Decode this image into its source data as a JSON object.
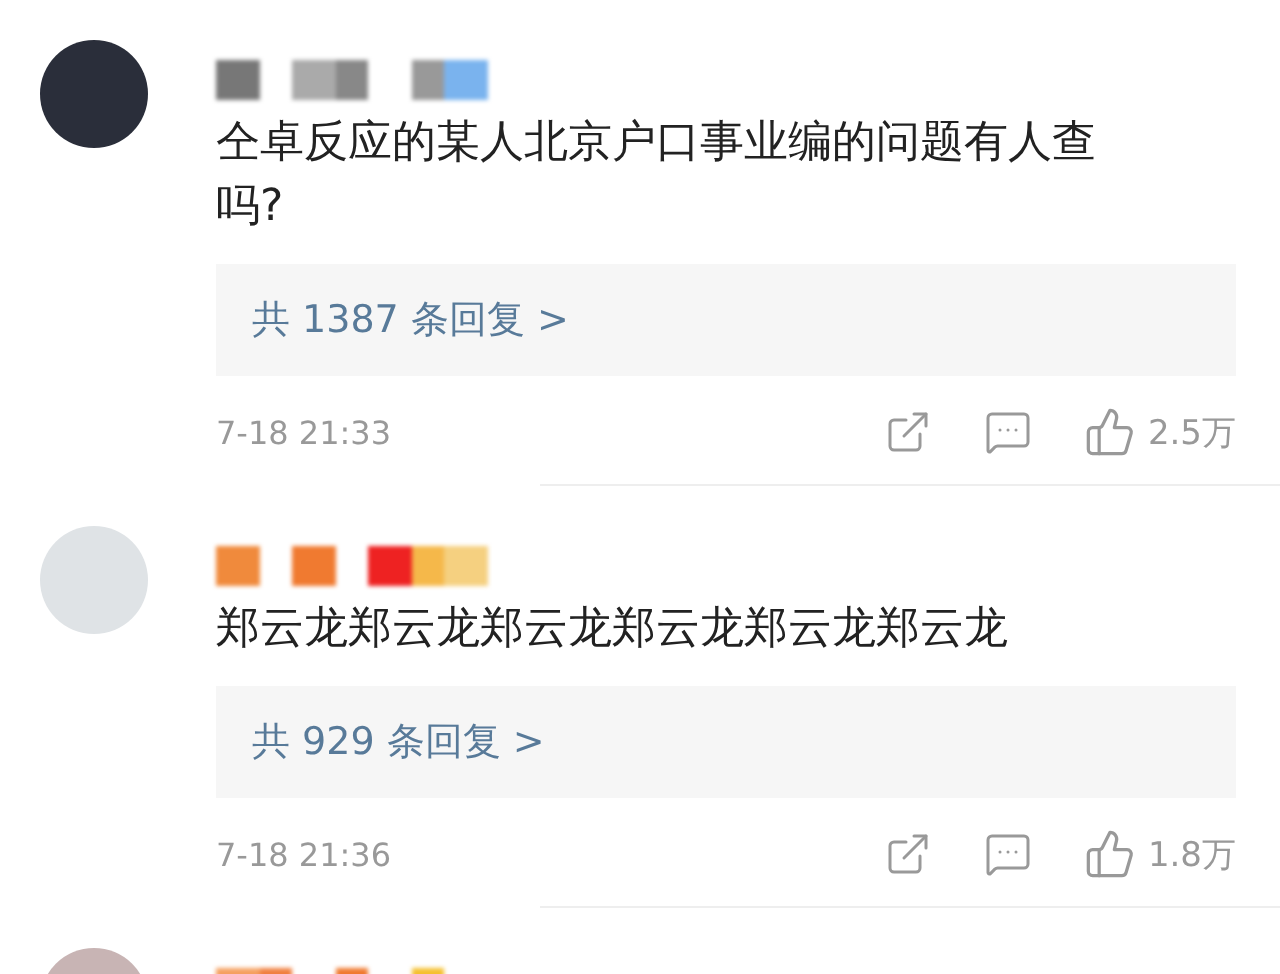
{
  "comments": [
    {
      "kind": "full",
      "text": "仝卓反应的某人北京户口事业编的问题有人查吗?",
      "replies": "共 1387 条回复 >",
      "time": "7-18 21:33",
      "likes": "2.5万"
    },
    {
      "kind": "full",
      "text": "郑云龙郑云龙郑云龙郑云龙郑云龙郑云龙",
      "replies": "共 929 条回复 >",
      "time": "7-18 21:36",
      "likes": "1.8万"
    },
    {
      "kind": "cut"
    }
  ]
}
